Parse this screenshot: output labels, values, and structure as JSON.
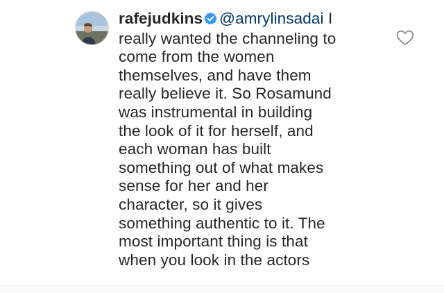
{
  "comment": {
    "username": "rafejudkins",
    "mention": "@amrylinsadai",
    "lines": [
      " I",
      "really wanted the channeling to",
      "come from the women",
      "themselves, and have them",
      "really believe it.  So Rosamund",
      "was instrumental in building",
      "the look of it for herself, and",
      "each woman has built",
      "something out of what makes",
      "sense for her and her",
      "character, so it gives",
      "something authentic to it.  The",
      "most important thing is that",
      "when you look in the actors"
    ],
    "avatar_icon": "profile-photo",
    "verified_icon": "verified-badge-icon",
    "like_icon": "heart-outline-icon"
  },
  "colors": {
    "text": "#262626",
    "mention": "#00376b",
    "verified": "#3897f0",
    "heart_stroke": "#8e8e8e"
  }
}
